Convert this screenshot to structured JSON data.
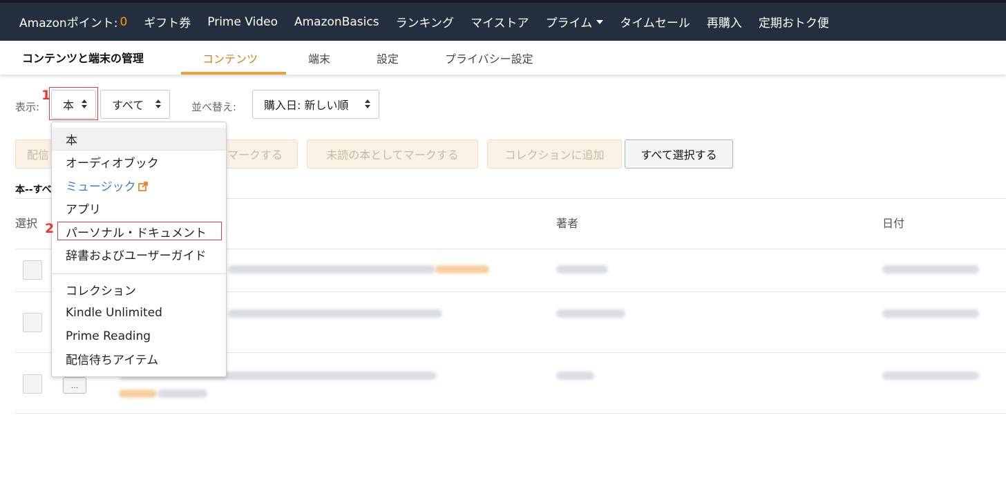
{
  "topnav": {
    "points_label": "Amazonポイント:",
    "points_value": "0",
    "items": [
      "ギフト券",
      "Prime Video",
      "AmazonBasics",
      "ランキング",
      "マイストア",
      "プライム",
      "タイムセール",
      "再購入",
      "定期おトク便"
    ]
  },
  "subnav": {
    "title": "コンテンツと端末の管理",
    "tabs": [
      "コンテンツ",
      "端末",
      "設定",
      "プライバシー設定"
    ],
    "active_tab": "コンテンツ"
  },
  "filters": {
    "display_label": "表示:",
    "type_value": "本",
    "scope_value": "すべて",
    "sort_label": "並べ替え:",
    "sort_value": "購入日: 新しい順"
  },
  "annotations": {
    "step1": "1",
    "step2": "2"
  },
  "actions": {
    "deliver": "配信",
    "mark_read": "マークする",
    "mark_unread": "未読の本としてマークする",
    "add_collection": "コレクションに追加",
    "select_all": "すべて選択する"
  },
  "section_title": "本--すべ",
  "columns": {
    "select": "選択",
    "author": "著者",
    "date": "日付"
  },
  "rows": [
    {
      "more": ""
    },
    {
      "more": ""
    },
    {
      "more": "..."
    }
  ],
  "dropdown": {
    "items": [
      "本",
      "オーディオブック",
      "ミュージック",
      "アプリ",
      "パーソナル・ドキュメント",
      "辞書およびユーザーガイド",
      "コレクション",
      "Kindle Unlimited",
      "Prime Reading",
      "配信待ちアイテム"
    ],
    "selected": "本",
    "highlighted": "パーソナル・ドキュメント"
  },
  "colors": {
    "nav_bg": "#232f3e",
    "accent_orange": "#e47911",
    "annotation_red": "#e53935",
    "link_blue": "#3b7fc4"
  }
}
